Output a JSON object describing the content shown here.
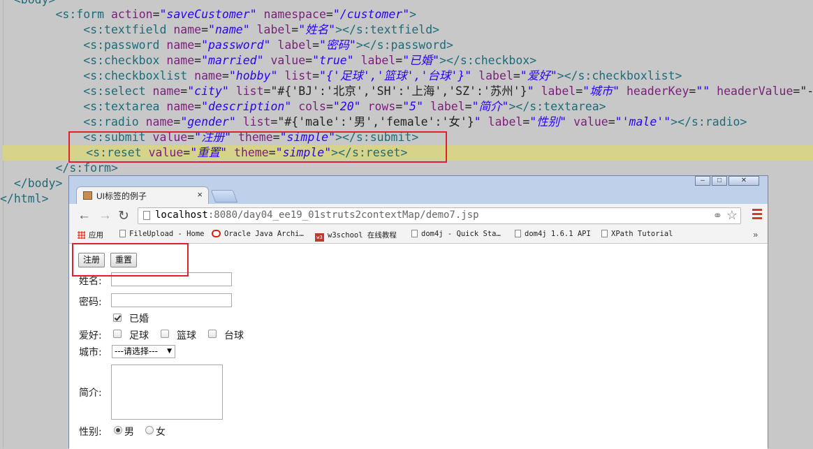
{
  "code": {
    "lines": [
      {
        "parts": [
          {
            "c": "tag",
            "t": "  <body>"
          }
        ]
      },
      {
        "parts": [
          {
            "c": "tag",
            "t": "        <s:form "
          },
          {
            "c": "an",
            "t": "action"
          },
          {
            "c": "tx",
            "t": "="
          },
          {
            "c": "av",
            "t": "\"saveCustomer\""
          },
          {
            "c": "tx",
            "t": " "
          },
          {
            "c": "an",
            "t": "namespace"
          },
          {
            "c": "tx",
            "t": "="
          },
          {
            "c": "av",
            "t": "\"/customer\""
          },
          {
            "c": "tag",
            "t": ">"
          }
        ]
      },
      {
        "parts": [
          {
            "c": "tag",
            "t": "            <s:textfield "
          },
          {
            "c": "an",
            "t": "name"
          },
          {
            "c": "tx",
            "t": "="
          },
          {
            "c": "av",
            "t": "\"name\""
          },
          {
            "c": "tx",
            "t": " "
          },
          {
            "c": "an",
            "t": "label"
          },
          {
            "c": "tx",
            "t": "="
          },
          {
            "c": "av",
            "t": "\"姓名\""
          },
          {
            "c": "tag",
            "t": "></s:textfield>"
          }
        ]
      },
      {
        "parts": [
          {
            "c": "tag",
            "t": "            <s:password "
          },
          {
            "c": "an",
            "t": "name"
          },
          {
            "c": "tx",
            "t": "="
          },
          {
            "c": "av",
            "t": "\"password\""
          },
          {
            "c": "tx",
            "t": " "
          },
          {
            "c": "an",
            "t": "label"
          },
          {
            "c": "tx",
            "t": "="
          },
          {
            "c": "av",
            "t": "\"密码\""
          },
          {
            "c": "tag",
            "t": "></s:password>"
          }
        ]
      },
      {
        "parts": [
          {
            "c": "tag",
            "t": "            <s:checkbox "
          },
          {
            "c": "an",
            "t": "name"
          },
          {
            "c": "tx",
            "t": "="
          },
          {
            "c": "av",
            "t": "\"married\""
          },
          {
            "c": "tx",
            "t": " "
          },
          {
            "c": "an",
            "t": "value"
          },
          {
            "c": "tx",
            "t": "="
          },
          {
            "c": "av",
            "t": "\"true\""
          },
          {
            "c": "tx",
            "t": " "
          },
          {
            "c": "an",
            "t": "label"
          },
          {
            "c": "tx",
            "t": "="
          },
          {
            "c": "av",
            "t": "\"已婚\""
          },
          {
            "c": "tag",
            "t": "></s:checkbox>"
          }
        ]
      },
      {
        "parts": [
          {
            "c": "tag",
            "t": "            <s:checkboxlist "
          },
          {
            "c": "an",
            "t": "name"
          },
          {
            "c": "tx",
            "t": "="
          },
          {
            "c": "av",
            "t": "\"hobby\""
          },
          {
            "c": "tx",
            "t": " "
          },
          {
            "c": "an",
            "t": "list"
          },
          {
            "c": "tx",
            "t": "="
          },
          {
            "c": "av",
            "t": "\"{'足球','篮球','台球'}\""
          },
          {
            "c": "tx",
            "t": " "
          },
          {
            "c": "an",
            "t": "label"
          },
          {
            "c": "tx",
            "t": "="
          },
          {
            "c": "av",
            "t": "\"爱好\""
          },
          {
            "c": "tag",
            "t": "></s:checkboxlist>"
          }
        ]
      },
      {
        "parts": [
          {
            "c": "tag",
            "t": "            <s:select "
          },
          {
            "c": "an",
            "t": "name"
          },
          {
            "c": "tx",
            "t": "="
          },
          {
            "c": "av",
            "t": "\"city\""
          },
          {
            "c": "tx",
            "t": " "
          },
          {
            "c": "an",
            "t": "list"
          },
          {
            "c": "tx",
            "t": "=\"#{'BJ':'北京','SH':'上海','SZ':'苏州'}"
          },
          {
            "c": "av",
            "t": "\""
          },
          {
            "c": "tx",
            "t": " "
          },
          {
            "c": "an",
            "t": "label"
          },
          {
            "c": "tx",
            "t": "="
          },
          {
            "c": "av",
            "t": "\"城市\""
          },
          {
            "c": "tx",
            "t": " "
          },
          {
            "c": "an",
            "t": "headerKey"
          },
          {
            "c": "tx",
            "t": "="
          },
          {
            "c": "av",
            "t": "\"\""
          },
          {
            "c": "tx",
            "t": " "
          },
          {
            "c": "an",
            "t": "headerValue"
          },
          {
            "c": "tx",
            "t": "=\"-"
          }
        ]
      },
      {
        "parts": [
          {
            "c": "tag",
            "t": "            <s:textarea "
          },
          {
            "c": "an",
            "t": "name"
          },
          {
            "c": "tx",
            "t": "="
          },
          {
            "c": "av",
            "t": "\"description\""
          },
          {
            "c": "tx",
            "t": " "
          },
          {
            "c": "an",
            "t": "cols"
          },
          {
            "c": "tx",
            "t": "="
          },
          {
            "c": "av",
            "t": "\"20\""
          },
          {
            "c": "tx",
            "t": " "
          },
          {
            "c": "an",
            "t": "rows"
          },
          {
            "c": "tx",
            "t": "="
          },
          {
            "c": "av",
            "t": "\"5\""
          },
          {
            "c": "tx",
            "t": " "
          },
          {
            "c": "an",
            "t": "label"
          },
          {
            "c": "tx",
            "t": "="
          },
          {
            "c": "av",
            "t": "\"简介\""
          },
          {
            "c": "tag",
            "t": "></s:textarea>"
          }
        ]
      },
      {
        "parts": [
          {
            "c": "tag",
            "t": "            <s:radio "
          },
          {
            "c": "an",
            "t": "name"
          },
          {
            "c": "tx",
            "t": "="
          },
          {
            "c": "av",
            "t": "\"gender\""
          },
          {
            "c": "tx",
            "t": " "
          },
          {
            "c": "an",
            "t": "list"
          },
          {
            "c": "tx",
            "t": "=\"#{'male':'男','female':'女'}"
          },
          {
            "c": "av",
            "t": "\""
          },
          {
            "c": "tx",
            "t": " "
          },
          {
            "c": "an",
            "t": "label"
          },
          {
            "c": "tx",
            "t": "="
          },
          {
            "c": "av",
            "t": "\"性别\""
          },
          {
            "c": "tx",
            "t": " "
          },
          {
            "c": "an",
            "t": "value"
          },
          {
            "c": "tx",
            "t": "="
          },
          {
            "c": "av",
            "t": "\"'male'\""
          },
          {
            "c": "tag",
            "t": "></s:radio>"
          }
        ]
      },
      {
        "parts": [
          {
            "c": "tag",
            "t": "            <s:submit "
          },
          {
            "c": "an",
            "t": "value"
          },
          {
            "c": "tx",
            "t": "="
          },
          {
            "c": "av",
            "t": "\"注册\""
          },
          {
            "c": "tx",
            "t": " "
          },
          {
            "c": "an",
            "t": "theme"
          },
          {
            "c": "tx",
            "t": "="
          },
          {
            "c": "av",
            "t": "\"simple\""
          },
          {
            "c": "tag",
            "t": "></s:submit>"
          }
        ]
      },
      {
        "parts": [
          {
            "c": "tag",
            "t": "            <s:reset "
          },
          {
            "c": "an",
            "t": "value"
          },
          {
            "c": "tx",
            "t": "="
          },
          {
            "c": "av",
            "t": "\"重置\""
          },
          {
            "c": "tx",
            "t": " "
          },
          {
            "c": "an",
            "t": "theme"
          },
          {
            "c": "tx",
            "t": "="
          },
          {
            "c": "av",
            "t": "\"simple\""
          },
          {
            "c": "tag",
            "t": "></s:reset>"
          }
        ]
      },
      {
        "parts": [
          {
            "c": "tag",
            "t": "        </s:form>"
          }
        ]
      },
      {
        "parts": [
          {
            "c": "tag",
            "t": "  </body>"
          }
        ]
      },
      {
        "parts": [
          {
            "c": "tag",
            "t": "</html>"
          }
        ]
      }
    ]
  },
  "browser": {
    "tab_title": "UI标签的例子",
    "tab_close": "×",
    "window_controls": {
      "minimize": "–",
      "maximize": "□",
      "close": "✕"
    },
    "url_host": "localhost",
    "url_rest": ":8080/day04_ee19_01struts2contextMap/demo7.jsp",
    "bookmarks": [
      {
        "icon": "apps-icon",
        "label": "应用"
      },
      {
        "icon": "page-icon",
        "label": "FileUpload - Home"
      },
      {
        "icon": "oracle-icon",
        "label": "Oracle Java Archi…"
      },
      {
        "icon": "w3school-icon",
        "label": "w3school 在线教程"
      },
      {
        "icon": "page-icon",
        "label": "dom4j - Quick Sta…"
      },
      {
        "icon": "page-icon",
        "label": "dom4j 1.6.1 API"
      },
      {
        "icon": "page-icon",
        "label": "XPath Tutorial"
      }
    ],
    "bookmarks_more": "»",
    "w3_badge": "w3"
  },
  "form": {
    "submit_label": "注册",
    "reset_label": "重置",
    "name_label": "姓名:",
    "name_value": "",
    "password_label": "密码:",
    "password_value": "",
    "married_label": "已婚",
    "married_checked": true,
    "hobby_label": "爱好:",
    "hobby_options": [
      "足球",
      "篮球",
      "台球"
    ],
    "city_label": "城市:",
    "city_selected": "---请选择---",
    "description_label": "简介:",
    "gender_label": "性别:",
    "gender_options": [
      "男",
      "女"
    ],
    "gender_selected": "男"
  },
  "colors": {
    "highlight_box": "#e0202a",
    "line_highlight": "#d8d38a",
    "editor_bg": "#c8c8c8"
  }
}
